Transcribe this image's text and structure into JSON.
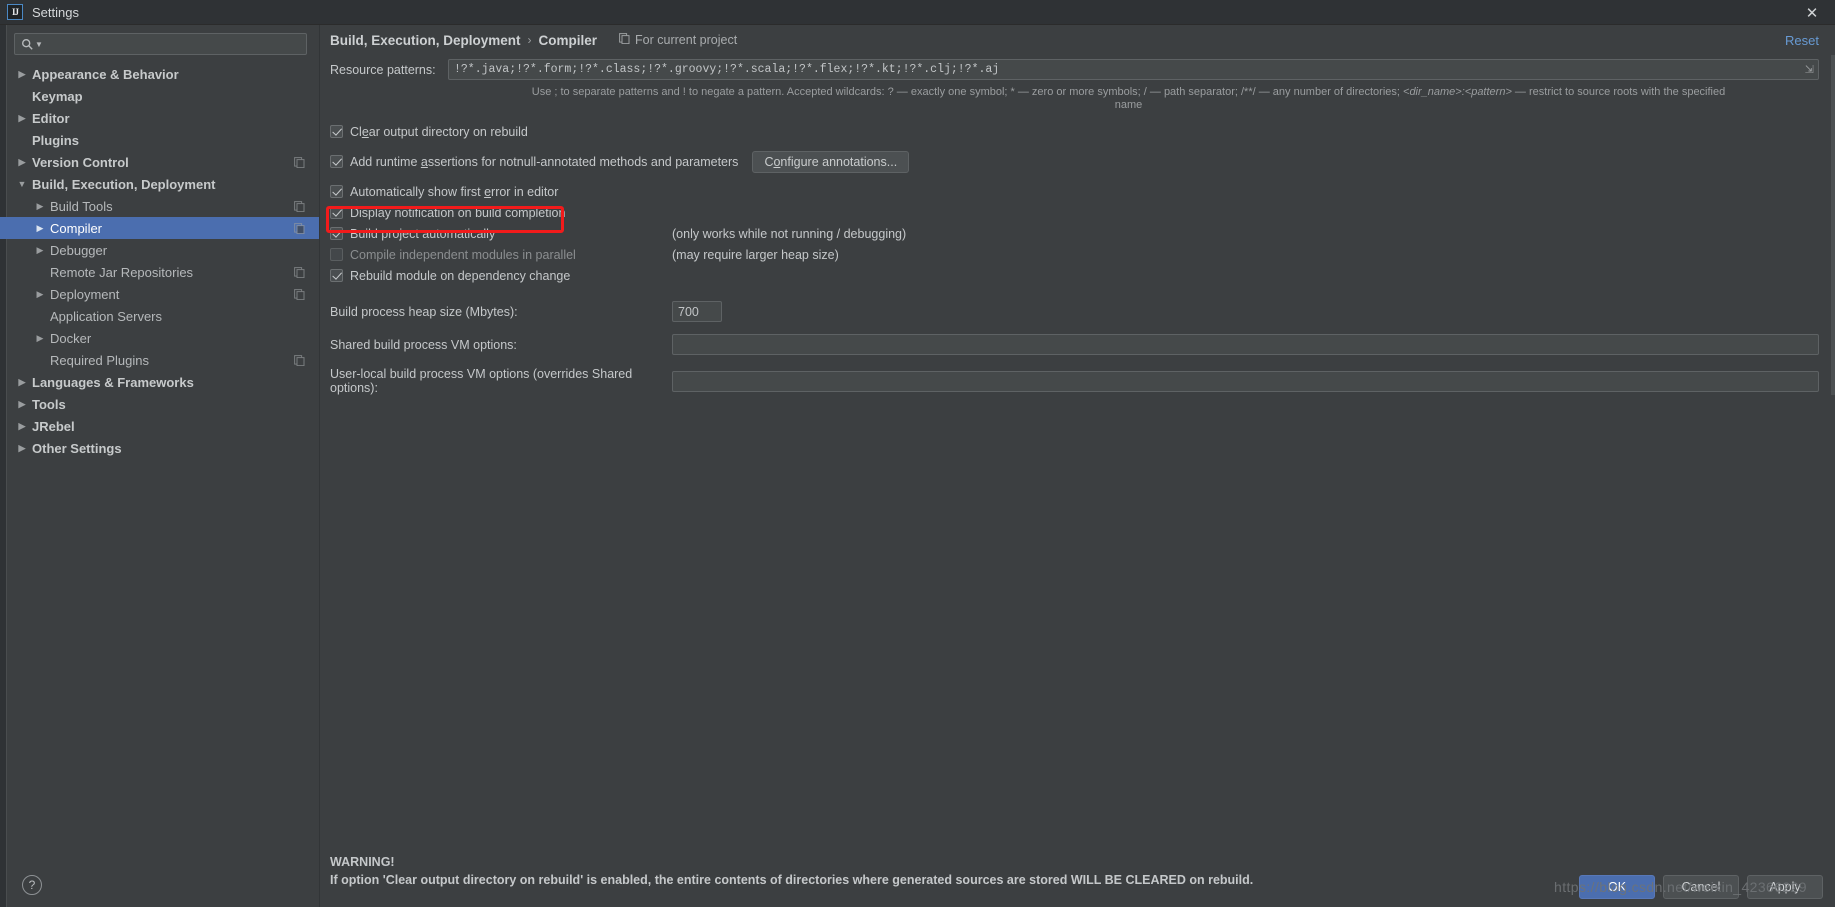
{
  "window": {
    "title": "Settings",
    "app_icon_label": "IJ",
    "close_icon": "close-icon"
  },
  "sidebar": {
    "search": {
      "value": "",
      "placeholder": "",
      "icon": "search-icon"
    },
    "help_button": "?",
    "items": [
      {
        "label": "Appearance & Behavior",
        "level": 1,
        "arrow": "collapsed",
        "bold": true,
        "selected": false,
        "badge": false
      },
      {
        "label": "Keymap",
        "level": 1,
        "arrow": "none",
        "bold": true,
        "selected": false,
        "badge": false
      },
      {
        "label": "Editor",
        "level": 1,
        "arrow": "collapsed",
        "bold": true,
        "selected": false,
        "badge": false
      },
      {
        "label": "Plugins",
        "level": 1,
        "arrow": "none",
        "bold": true,
        "selected": false,
        "badge": false
      },
      {
        "label": "Version Control",
        "level": 1,
        "arrow": "collapsed",
        "bold": true,
        "selected": false,
        "badge": true
      },
      {
        "label": "Build, Execution, Deployment",
        "level": 1,
        "arrow": "expanded",
        "bold": true,
        "selected": false,
        "badge": false
      },
      {
        "label": "Build Tools",
        "level": 2,
        "arrow": "collapsed",
        "bold": false,
        "selected": false,
        "badge": true
      },
      {
        "label": "Compiler",
        "level": 2,
        "arrow": "collapsed",
        "bold": false,
        "selected": true,
        "badge": true
      },
      {
        "label": "Debugger",
        "level": 2,
        "arrow": "collapsed",
        "bold": false,
        "selected": false,
        "badge": false
      },
      {
        "label": "Remote Jar Repositories",
        "level": 2,
        "arrow": "none",
        "bold": false,
        "selected": false,
        "badge": true
      },
      {
        "label": "Deployment",
        "level": 2,
        "arrow": "collapsed",
        "bold": false,
        "selected": false,
        "badge": true
      },
      {
        "label": "Application Servers",
        "level": 2,
        "arrow": "none",
        "bold": false,
        "selected": false,
        "badge": false
      },
      {
        "label": "Docker",
        "level": 2,
        "arrow": "collapsed",
        "bold": false,
        "selected": false,
        "badge": false
      },
      {
        "label": "Required Plugins",
        "level": 2,
        "arrow": "none",
        "bold": false,
        "selected": false,
        "badge": true
      },
      {
        "label": "Languages & Frameworks",
        "level": 1,
        "arrow": "collapsed",
        "bold": true,
        "selected": false,
        "badge": false
      },
      {
        "label": "Tools",
        "level": 1,
        "arrow": "collapsed",
        "bold": true,
        "selected": false,
        "badge": false
      },
      {
        "label": "JRebel",
        "level": 1,
        "arrow": "collapsed",
        "bold": true,
        "selected": false,
        "badge": false
      },
      {
        "label": "Other Settings",
        "level": 1,
        "arrow": "collapsed",
        "bold": true,
        "selected": false,
        "badge": false
      }
    ]
  },
  "header": {
    "breadcrumb_root": "Build, Execution, Deployment",
    "breadcrumb_sep": "›",
    "breadcrumb_leaf": "Compiler",
    "scope_icon": "copy-icon",
    "scope_label": "For current project",
    "reset_label": "Reset"
  },
  "main": {
    "resource_patterns": {
      "label": "Resource patterns:",
      "value": "!?*.java;!?*.form;!?*.class;!?*.groovy;!?*.scala;!?*.flex;!?*.kt;!?*.clj;!?*.aj",
      "expand_icon": "expand-icon"
    },
    "hint_line_1": "Use ; to separate patterns and ! to negate a pattern. Accepted wildcards: ? — exactly one symbol; * — zero or more symbols; / — path separator; /**/ — any number of directories; ",
    "hint_italic_1": "<dir_name>:<pattern>",
    "hint_line_1_tail": " — restrict to source roots with the specified",
    "hint_line_2": "name",
    "checkboxes": [
      {
        "label_pre": "Cl",
        "mnemonic": "e",
        "label_post": "ar output directory on rebuild",
        "checked": true,
        "enabled": true,
        "note": ""
      },
      {
        "label_pre": "Add runtime ",
        "mnemonic": "a",
        "label_post": "ssertions for notnull-annotated methods and parameters",
        "checked": true,
        "enabled": true,
        "note": ""
      },
      {
        "label_pre": "Automatically show first ",
        "mnemonic": "e",
        "label_post": "rror in editor",
        "checked": true,
        "enabled": true,
        "note": ""
      },
      {
        "label_pre": "Display notification on build completion",
        "mnemonic": "",
        "label_post": "",
        "checked": true,
        "enabled": true,
        "note": ""
      },
      {
        "label_pre": "Build project automatically",
        "mnemonic": "",
        "label_post": "",
        "checked": true,
        "enabled": true,
        "note": "(only works while not running / debugging)"
      },
      {
        "label_pre": "Compile independent modules in parallel",
        "mnemonic": "",
        "label_post": "",
        "checked": false,
        "enabled": false,
        "note": "(may require larger heap size)"
      },
      {
        "label_pre": "Rebuild module on dependency change",
        "mnemonic": "",
        "label_post": "",
        "checked": true,
        "enabled": true,
        "note": ""
      }
    ],
    "configure_annotations": {
      "label_pre": "C",
      "mnemonic": "o",
      "label_post": "nfigure annotations..."
    },
    "heap_size": {
      "label": "Build process heap size (Mbytes):",
      "value": "700"
    },
    "shared_vm_options": {
      "label": "Shared build process VM options:",
      "value": ""
    },
    "user_vm_options": {
      "label": "User-local build process VM options (overrides Shared options):",
      "value": ""
    },
    "warning_title": "WARNING!",
    "warning_text": "If option 'Clear output directory on rebuild' is enabled, the entire contents of directories where generated sources are stored WILL BE CLEARED on rebuild."
  },
  "footer": {
    "ok": "OK",
    "cancel": "Cancel",
    "apply": "Apply"
  },
  "watermark": "https://blog.csdn.net/weixin_42366229",
  "colors": {
    "accent": "#4b6eaf",
    "link": "#689ad3",
    "annotation": "#f21b1b",
    "panel_bg": "#3c3f41",
    "field_bg": "#45494a"
  }
}
